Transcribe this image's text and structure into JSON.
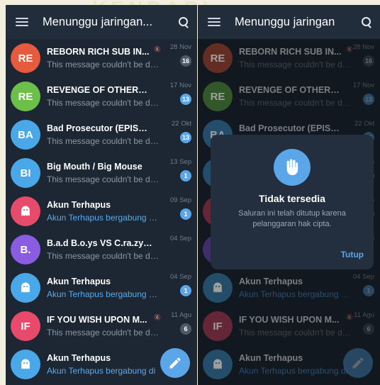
{
  "watermark": "KENDARI",
  "left": {
    "title": "Menunggu jaringan...",
    "chats": [
      {
        "initials": "RE",
        "color": "#e65b3e",
        "name": "REBORN RICH SUB IN...",
        "muted": true,
        "time": "28 Nov",
        "preview": "This message couldn't be dis...",
        "badge": "16",
        "badge_style": "gray",
        "preview_style": "gray"
      },
      {
        "initials": "RE",
        "color": "#6cc04a",
        "name": "REVENGE OF OTHERS (T...",
        "muted": false,
        "time": "17 Nov",
        "preview": "This message couldn't be dis...",
        "badge": "13",
        "badge_style": "blue",
        "preview_style": "gray"
      },
      {
        "initials": "BA",
        "color": "#4aa8e8",
        "name": "Bad Prosecutor (EPISOD...",
        "muted": false,
        "time": "22 Okt",
        "preview": "This message couldn't be dis...",
        "badge": "13",
        "badge_style": "blue",
        "preview_style": "gray"
      },
      {
        "initials": "BI",
        "color": "#4aa8e8",
        "name": "Big Mouth / Big Mouse",
        "muted": false,
        "time": "13 Sep",
        "preview": "This message couldn't be disp...",
        "badge": "1",
        "badge_style": "blue",
        "preview_style": "gray"
      },
      {
        "initials": "ghost",
        "color": "#e84a6c",
        "name": "Akun Terhapus",
        "muted": false,
        "time": "09 Sep",
        "preview": "Akun Terhapus bergabung di T...",
        "badge": "1",
        "badge_style": "blue",
        "preview_style": "blue"
      },
      {
        "initials": "B.",
        "color": "#8a5de0",
        "name": "B.a.d B.o.ys VS C.ra.zy G...",
        "muted": false,
        "time": "04 Sep",
        "preview": "This message couldn't be displaye...",
        "badge": "",
        "badge_style": "none",
        "preview_style": "gray"
      },
      {
        "initials": "ghost",
        "color": "#4aa8e8",
        "name": "Akun Terhapus",
        "muted": false,
        "time": "04 Sep",
        "preview": "Akun Terhapus bergabung di T...",
        "badge": "1",
        "badge_style": "blue",
        "preview_style": "blue"
      },
      {
        "initials": "IF",
        "color": "#e84a6c",
        "name": "IF YOU WISH UPON M...",
        "muted": true,
        "time": "11 Agu",
        "preview": "This message couldn't be disp...",
        "badge": "6",
        "badge_style": "gray",
        "preview_style": "gray"
      },
      {
        "initials": "ghost",
        "color": "#4aa8e8",
        "name": "Akun Terhapus",
        "muted": false,
        "time": "",
        "preview": "Akun Terhapus bergabung di",
        "badge": "",
        "badge_style": "none",
        "preview_style": "blue"
      }
    ]
  },
  "right": {
    "title": "Menunggu jaringan",
    "dialog": {
      "title": "Tidak tersedia",
      "text": "Saluran ini telah ditutup karena pelanggaran hak cipta.",
      "button": "Tutup"
    }
  }
}
